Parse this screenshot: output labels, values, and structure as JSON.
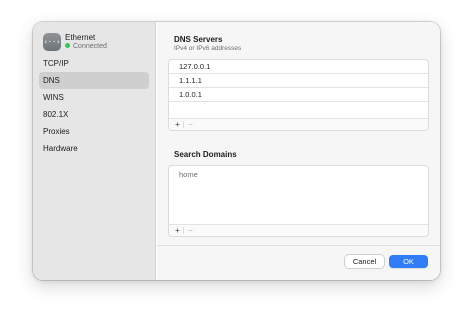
{
  "colors": {
    "accent": "#2f7cf6",
    "status_connected": "#35c759"
  },
  "interface": {
    "icon": "ethernet-icon",
    "icon_glyph": "‹··›",
    "name": "Ethernet",
    "status": "Connected"
  },
  "sidebar": {
    "items": [
      {
        "label": "TCP/IP",
        "selected": false
      },
      {
        "label": "DNS",
        "selected": true
      },
      {
        "label": "WINS",
        "selected": false
      },
      {
        "label": "802.1X",
        "selected": false
      },
      {
        "label": "Proxies",
        "selected": false
      },
      {
        "label": "Hardware",
        "selected": false
      }
    ]
  },
  "dns_servers": {
    "title": "DNS Servers",
    "subtitle": "IPv4 or IPv6 addresses",
    "entries": [
      "127.0.0.1",
      "1.1.1.1",
      "1.0.0.1"
    ],
    "add_label": "+",
    "remove_label": "−"
  },
  "search_domains": {
    "title": "Search Domains",
    "entries": [
      "home"
    ],
    "add_label": "+",
    "remove_label": "−"
  },
  "buttons": {
    "cancel": "Cancel",
    "ok": "OK"
  }
}
